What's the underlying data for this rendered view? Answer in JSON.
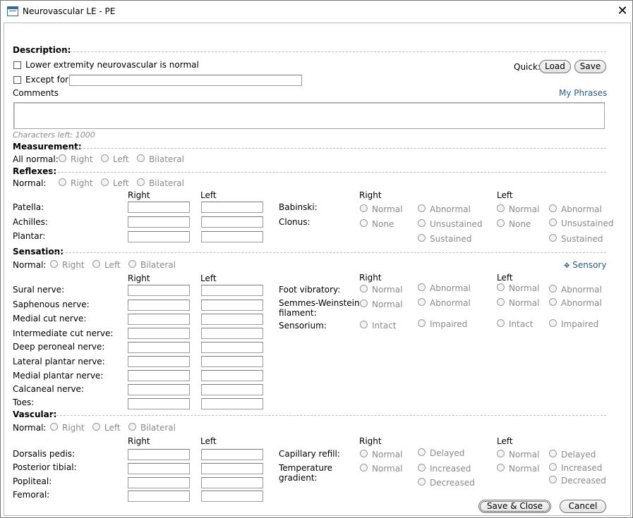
{
  "window": {
    "title": "Neurovascular LE - PE",
    "close_glyph": "✕"
  },
  "description": {
    "section": "Description:",
    "normal_label": "Lower extremity neurovascular is normal",
    "except_label": "Except for",
    "except_value": "",
    "quick_label": "Quick:",
    "load_label": "Load",
    "save_label": "Save",
    "comments_label": "Comments",
    "my_phrases_label": "My Phrases",
    "comments_value": "",
    "chars_left": "Characters left: 1000"
  },
  "measurement": {
    "section": "Measurement:",
    "all_normal_label": "All normal:",
    "options": [
      "Right",
      "Left",
      "Bilateral"
    ]
  },
  "reflexes": {
    "section": "Reflexes:",
    "normal_label": "Normal:",
    "options": [
      "Right",
      "Left",
      "Bilateral"
    ],
    "col_right": "Right",
    "col_left": "Left",
    "rows": [
      "Patella:",
      "Achilles:",
      "Plantar:"
    ],
    "right_hdr": "Right",
    "left_hdr": "Left",
    "babinski": {
      "label": "Babinski:",
      "normal": "Normal",
      "abnormal": "Abnormal"
    },
    "clonus": {
      "label": "Clonus:",
      "none": "None",
      "unsustained": "Unsustained",
      "sustained": "Sustained"
    }
  },
  "sensation": {
    "section": "Sensation:",
    "normal_label": "Normal:",
    "options": [
      "Right",
      "Left",
      "Bilateral"
    ],
    "sensory_link": "Sensory",
    "col_right": "Right",
    "col_left": "Left",
    "rows": [
      "Sural nerve:",
      "Saphenous nerve:",
      "Medial cut nerve:",
      "Intermediate cut nerve:",
      "Deep peroneal nerve:",
      "Lateral plantar nerve:",
      "Medial plantar nerve:",
      "Calcaneal nerve:",
      "Toes:"
    ],
    "right_hdr": "Right",
    "left_hdr": "Left",
    "foot_vibratory": {
      "label": "Foot vibratory:",
      "normal": "Normal",
      "abnormal": "Abnormal"
    },
    "semmes": {
      "label1": "Semmes-Weinstein",
      "label2": "filament:",
      "normal": "Normal",
      "abnormal": "Abnormal"
    },
    "sensorium": {
      "label": "Sensorium:",
      "intact": "Intact",
      "impaired": "Impaired"
    }
  },
  "vascular": {
    "section": "Vascular:",
    "normal_label": "Normal:",
    "options": [
      "Right",
      "Left",
      "Bilateral"
    ],
    "col_right": "Right",
    "col_left": "Left",
    "rows": [
      "Dorsalis pedis:",
      "Posterior tibial:",
      "Popliteal:",
      "Femoral:"
    ],
    "right_hdr": "Right",
    "left_hdr": "Left",
    "capillary": {
      "label": "Capillary refill:",
      "normal": "Normal",
      "delayed": "Delayed"
    },
    "temperature": {
      "label1": "Temperature",
      "label2": "gradient:",
      "normal": "Normal",
      "increased": "Increased",
      "decreased": "Decreased"
    }
  },
  "footer": {
    "save_close_label": "Save & Close",
    "cancel_label": "Cancel"
  }
}
